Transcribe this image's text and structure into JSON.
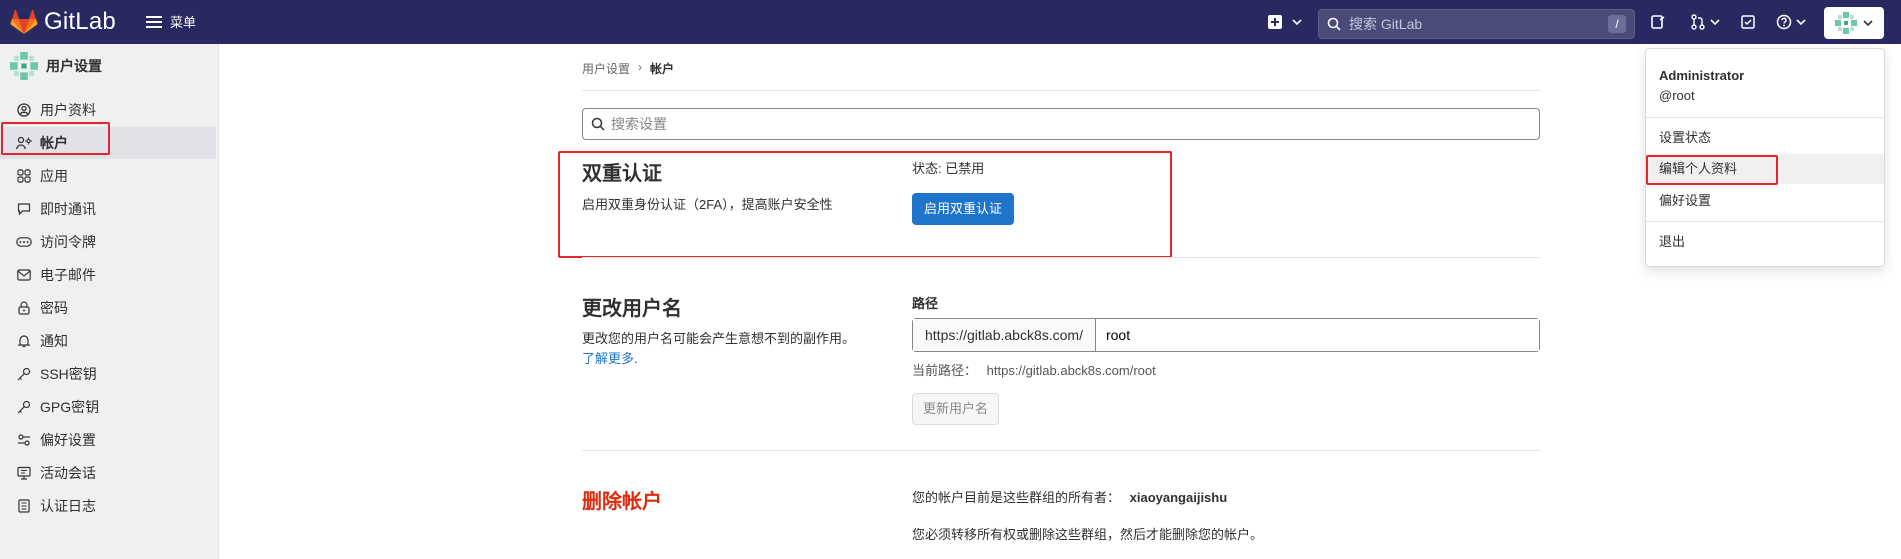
{
  "topbar": {
    "brand": "GitLab",
    "menu_label": "菜单",
    "search_placeholder": "搜索 GitLab",
    "search_shortcut": "/"
  },
  "sidebar": {
    "title": "用户设置",
    "items": [
      {
        "label": "用户资料",
        "icon": "user-icon"
      },
      {
        "label": "帐户",
        "icon": "account-icon"
      },
      {
        "label": "应用",
        "icon": "apps-icon"
      },
      {
        "label": "即时通讯",
        "icon": "chat-icon"
      },
      {
        "label": "访问令牌",
        "icon": "token-icon"
      },
      {
        "label": "电子邮件",
        "icon": "mail-icon"
      },
      {
        "label": "密码",
        "icon": "lock-icon"
      },
      {
        "label": "通知",
        "icon": "bell-icon"
      },
      {
        "label": "SSH密钥",
        "icon": "key-icon"
      },
      {
        "label": "GPG密钥",
        "icon": "key-icon"
      },
      {
        "label": "偏好设置",
        "icon": "preferences-icon"
      },
      {
        "label": "活动会话",
        "icon": "monitor-icon"
      },
      {
        "label": "认证日志",
        "icon": "log-icon"
      }
    ],
    "active_index": 1
  },
  "breadcrumb": {
    "parent": "用户设置",
    "separator": "›",
    "current": "帐户"
  },
  "settings_search": {
    "placeholder": "搜索设置"
  },
  "two_factor": {
    "title": "双重认证",
    "description": "启用双重身份认证（2FA），提高账户安全性",
    "status": "状态: 已禁用",
    "button": "启用双重认证"
  },
  "change_username": {
    "title": "更改用户名",
    "description": "更改您的用户名可能会产生意想不到的副作用。",
    "learn_more": "了解更多",
    "learn_more_suffix": ".",
    "path_label": "路径",
    "path_prefix": "https://gitlab.abck8s.com/",
    "path_value": "root",
    "current_path_label": "当前路径：",
    "current_path": "https://gitlab.abck8s.com/root",
    "button": "更新用户名"
  },
  "delete_account": {
    "title": "删除帐户",
    "owner_text": "您的帐户目前是这些群组的所有者：",
    "owner_group": "xiaoyangaijishu",
    "transfer_text": "您必须转移所有权或删除这些群组，然后才能删除您的帐户。"
  },
  "user_dropdown": {
    "name": "Administrator",
    "username": "@root",
    "items": [
      "设置状态",
      "编辑个人资料",
      "偏好设置"
    ],
    "sign_out": "退出"
  },
  "colors": {
    "topbar": "#292961",
    "primary": "#1f75cb",
    "danger": "#dd2b0e",
    "highlight_box": "#e3262c"
  }
}
